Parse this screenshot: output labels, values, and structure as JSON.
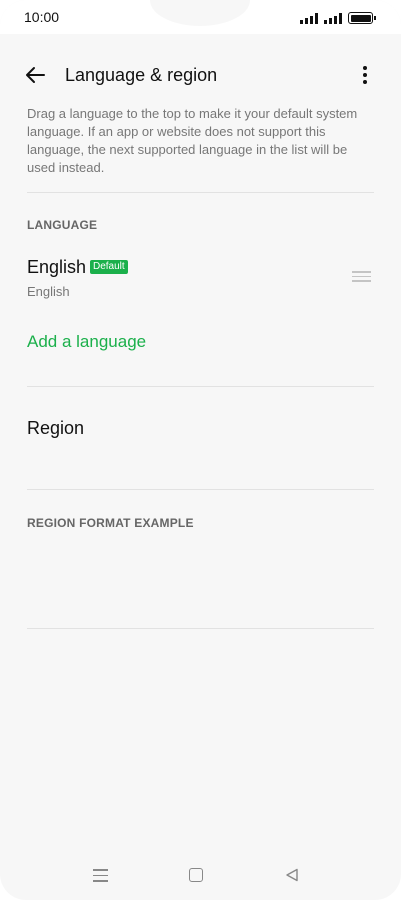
{
  "status_bar": {
    "time": "10:00"
  },
  "header": {
    "title": "Language & region",
    "back_icon": "arrow-left-icon",
    "more_icon": "more-vertical-icon"
  },
  "description": "Drag a language to the top to make it your default system language. If an app or website does not support this language, the next supported language in the list will be used instead.",
  "language_section": {
    "header": "LANGUAGE",
    "items": [
      {
        "name": "English",
        "badge": "Default",
        "subtitle": "English"
      }
    ],
    "add_label": "Add a language"
  },
  "region": {
    "label": "Region"
  },
  "region_format": {
    "header": "REGION FORMAT EXAMPLE"
  },
  "colors": {
    "accent": "#1bb04b",
    "background": "#f7f7f7"
  }
}
